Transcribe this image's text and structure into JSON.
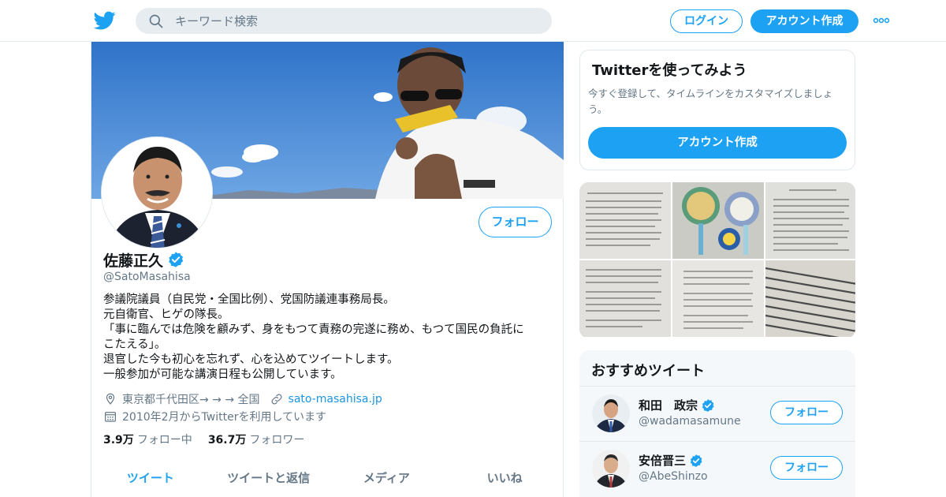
{
  "header": {
    "search_placeholder": "キーワード検索",
    "login_label": "ログイン",
    "signup_label": "アカウント作成"
  },
  "profile": {
    "follow_label": "フォロー",
    "name": "佐藤正久",
    "handle": "@SatoMasahisa",
    "bio_lines": [
      "参議院議員（自民党・全国比例）、党国防議連事務局長。",
      "元自衛官、ヒゲの隊長。",
      "「事に臨んでは危険を顧みず、身をもつて責務の完遂に務め、もつて国民の負託に",
      "こたえる」。",
      "退官した今も初心を忘れず、心を込めてツイートします。",
      "一般参加が可能な講演日程も公開しています。"
    ],
    "location": "東京都千代田区→ → → 全国",
    "website": "sato-masahisa.jp",
    "joined": "2010年2月からTwitterを利用しています",
    "following_count": "3.9万",
    "following_label": "フォロー中",
    "followers_count": "36.7万",
    "followers_label": "フォロワー",
    "tabs": [
      "ツイート",
      "ツイートと返信",
      "メディア",
      "いいね"
    ]
  },
  "signup_card": {
    "title": "Twitterを使ってみよう",
    "description": "今すぐ登録して、タイムラインをカスタマイズしましょう。",
    "button_label": "アカウント作成"
  },
  "recommended": {
    "title": "おすすめツイート",
    "users": [
      {
        "name": "和田　政宗",
        "handle": "@wadamasamune",
        "follow_label": "フォロー"
      },
      {
        "name": "安倍晋三",
        "handle": "@AbeShinzo",
        "follow_label": "フォロー"
      }
    ]
  },
  "colors": {
    "accent": "#1da1f2",
    "secondary_text": "#657786",
    "border": "#e1e8ed"
  }
}
